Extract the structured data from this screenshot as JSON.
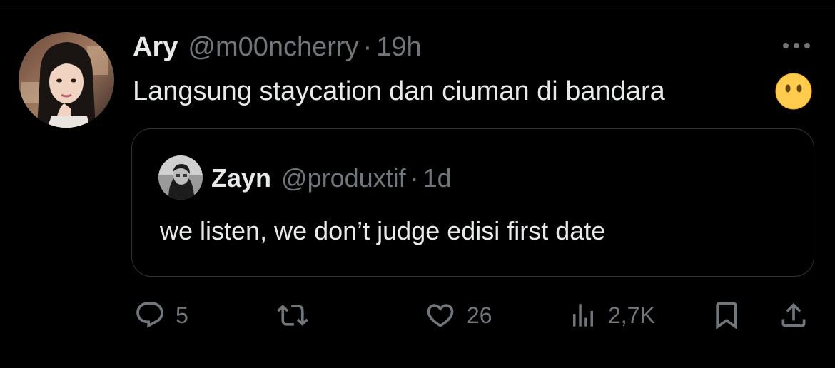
{
  "tweet": {
    "author_name": "Ary",
    "author_handle": "@m00ncherry",
    "separator": "·",
    "time": "19h",
    "text": "Langsung staycation dan ciuman di bandara",
    "emoji": "face-without-mouth-emoji"
  },
  "quote": {
    "author_name": "Zayn",
    "author_handle": "@produxtif",
    "separator": "·",
    "time": "1d",
    "text": "we listen, we don’t judge edisi first date"
  },
  "actions": {
    "replies": "5",
    "retweets": "",
    "likes": "26",
    "views": "2,7K"
  },
  "icons": {
    "reply": "reply-icon",
    "retweet": "retweet-icon",
    "like": "heart-icon",
    "views": "views-icon",
    "bookmark": "bookmark-icon",
    "share": "share-icon",
    "more": "more-icon"
  },
  "colors": {
    "background": "#000000",
    "text_primary": "#e7e9ea",
    "text_secondary": "#71767b",
    "border": "#2f3336",
    "emoji_yellow": "#ffcc4d"
  }
}
